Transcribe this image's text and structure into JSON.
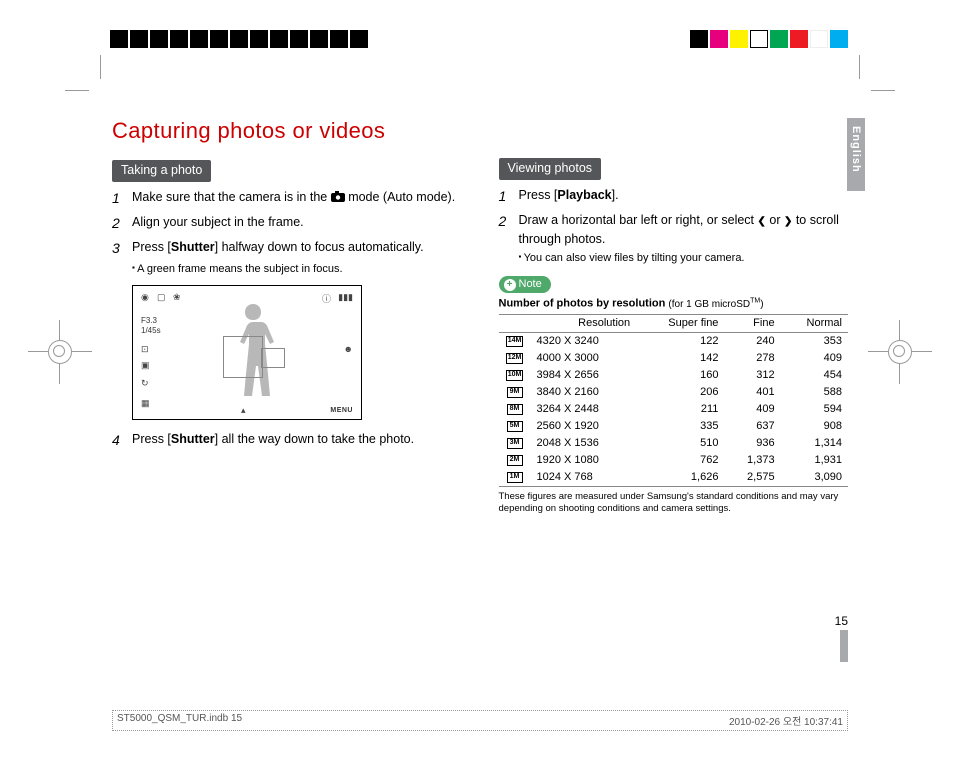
{
  "page_title": "Capturing photos or videos",
  "lang_tab": "English",
  "left": {
    "badge": "Taking a photo",
    "steps": [
      {
        "n": "1",
        "t": "Make sure that the camera is in the ⬤ mode (Auto mode).",
        "has_cam_icon": true
      },
      {
        "n": "2",
        "t": "Align your subject in the frame."
      },
      {
        "n": "3",
        "t": "Press [Shutter] halfway down to focus automatically."
      },
      {
        "n": "4",
        "t": "Press [Shutter] all the way down to take the photo."
      }
    ],
    "bullet_after_3": "A green frame means the subject in focus.",
    "display_text": {
      "aperture": "F3.3",
      "shutter": "1/45s",
      "menu": "MENU"
    }
  },
  "right": {
    "badge": "Viewing photos",
    "steps": [
      {
        "n": "1",
        "t": "Press [Playback]."
      },
      {
        "n": "2",
        "t": "Draw a horizontal bar left or right, or select ❮ or ❯ to scroll through photos."
      }
    ],
    "bullet_after_2": "You can also view files by tilting your camera.",
    "note_label": "Note",
    "table_title": "Number of photos by resolution",
    "table_title_sub": "(for 1 GB microSD™)",
    "table_headers": [
      "Resolution",
      "Super fine",
      "Fine",
      "Normal"
    ],
    "rows": [
      {
        "icon": "14M",
        "res": "4320 X 3240",
        "sf": "122",
        "f": "240",
        "n": "353"
      },
      {
        "icon": "12M",
        "res": "4000 X 3000",
        "sf": "142",
        "f": "278",
        "n": "409"
      },
      {
        "icon": "10M",
        "res": "3984 X 2656",
        "sf": "160",
        "f": "312",
        "n": "454"
      },
      {
        "icon": "9M",
        "res": "3840 X 2160",
        "sf": "206",
        "f": "401",
        "n": "588"
      },
      {
        "icon": "8M",
        "res": "3264 X 2448",
        "sf": "211",
        "f": "409",
        "n": "594"
      },
      {
        "icon": "5M",
        "res": "2560 X 1920",
        "sf": "335",
        "f": "637",
        "n": "908"
      },
      {
        "icon": "3M",
        "res": "2048 X 1536",
        "sf": "510",
        "f": "936",
        "n": "1,314"
      },
      {
        "icon": "2M",
        "res": "1920 X 1080",
        "sf": "762",
        "f": "1,373",
        "n": "1,931"
      },
      {
        "icon": "1M",
        "res": "1024 X 768",
        "sf": "1,626",
        "f": "2,575",
        "n": "3,090"
      }
    ],
    "footnote": "These figures are measured under Samsung's standard conditions and may vary depending on shooting conditions and camera settings."
  },
  "page_number": "15",
  "footer_left": "ST5000_QSM_TUR.indb   15",
  "footer_right": "2010-02-26   오전 10:37:41",
  "colors": [
    "#000",
    "#000",
    "#000",
    "#000",
    "#000",
    "#000",
    "#000",
    "#000",
    "#e6007e",
    "#fff200",
    "#00a651",
    "#00aeef",
    "#ed1c24",
    "#000",
    "#000"
  ],
  "chart_data": {
    "type": "table",
    "title": "Number of photos by resolution (for 1 GB microSD™)",
    "columns": [
      "Resolution",
      "Super fine",
      "Fine",
      "Normal"
    ],
    "rows": [
      [
        "4320 X 3240",
        122,
        240,
        353
      ],
      [
        "4000 X 3000",
        142,
        278,
        409
      ],
      [
        "3984 X 2656",
        160,
        312,
        454
      ],
      [
        "3840 X 2160",
        206,
        401,
        588
      ],
      [
        "3264 X 2448",
        211,
        409,
        594
      ],
      [
        "2560 X 1920",
        335,
        637,
        908
      ],
      [
        "2048 X 1536",
        510,
        936,
        1314
      ],
      [
        "1920 X 1080",
        762,
        1373,
        1931
      ],
      [
        "1024 X 768",
        1626,
        2575,
        3090
      ]
    ]
  }
}
